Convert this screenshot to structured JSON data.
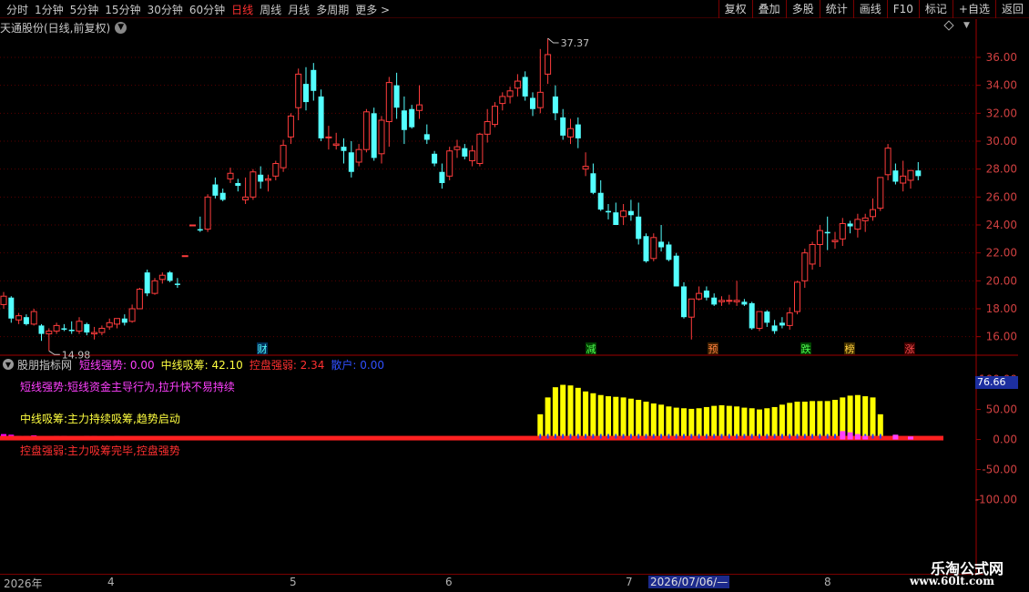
{
  "toolbar": {
    "periods": [
      "分时",
      "1分钟",
      "5分钟",
      "15分钟",
      "30分钟",
      "60分钟",
      "日线",
      "周线",
      "月线",
      "多周期",
      "更多 >"
    ],
    "active_period": "日线",
    "right_buttons": [
      "复权",
      "叠加",
      "多股",
      "统计",
      "画线",
      "F10",
      "标记",
      "+自选",
      "返回"
    ]
  },
  "stock_title": "天通股份(日线,前复权)",
  "indicator": {
    "name": "股朋指标网",
    "values": [
      {
        "label": "短线强势:",
        "value": "0.00",
        "color": "#ff40ff"
      },
      {
        "label": "中线吸筹:",
        "value": "42.10",
        "color": "#ffff40"
      },
      {
        "label": "控盘强弱:",
        "value": "2.34",
        "color": "#ff3030"
      },
      {
        "label": "散户:",
        "value": "0.00",
        "color": "#3050ff"
      }
    ],
    "desc1": "短线强势:短线资金主导行为,拉升快不易持续",
    "desc2": "中线吸筹:主力持续吸筹,趋势启动",
    "desc3": "控盘强弱:主力吸筹完毕,控盘强势",
    "cursor_value": "76.66"
  },
  "date_axis": {
    "labels": [
      "2026年",
      "4",
      "5",
      "6",
      "7",
      "8"
    ],
    "cursor_date": "2026/07/06/—"
  },
  "watermark": {
    "line1": "乐淘公式网",
    "line2": "www.60lt.com"
  },
  "colors": {
    "up": "#ff3c3c",
    "down": "#54ffff",
    "grid": "#5a0000",
    "axis": "#a00000"
  },
  "chart_data": [
    {
      "type": "candlestick",
      "ylim": [
        15,
        37.5
      ],
      "yticks": [
        16,
        18,
        20,
        22,
        24,
        26,
        28,
        30,
        32,
        34,
        36
      ],
      "high_label": "37.37",
      "low_label": "14.98",
      "event_markers": [
        "财",
        "减",
        "预",
        "跌",
        "榜",
        "涨"
      ],
      "ohlc": [
        [
          18.3,
          19.2,
          18.0,
          18.9
        ],
        [
          18.8,
          18.9,
          17.0,
          17.3
        ],
        [
          17.2,
          17.7,
          16.9,
          17.5
        ],
        [
          17.4,
          17.6,
          16.8,
          16.9
        ],
        [
          16.9,
          18.0,
          16.8,
          17.8
        ],
        [
          16.8,
          16.9,
          15.7,
          16.2
        ],
        [
          16.2,
          16.6,
          14.98,
          16.4
        ],
        [
          16.4,
          17.0,
          16.2,
          16.8
        ],
        [
          16.6,
          16.9,
          16.4,
          16.5
        ],
        [
          16.5,
          17.1,
          16.2,
          16.4
        ],
        [
          16.4,
          17.4,
          16.2,
          17.1
        ],
        [
          16.9,
          17.0,
          16.1,
          16.3
        ],
        [
          16.2,
          16.7,
          15.8,
          16.3
        ],
        [
          16.3,
          16.8,
          16.1,
          16.6
        ],
        [
          16.7,
          17.3,
          16.5,
          17.0
        ],
        [
          16.9,
          17.3,
          16.6,
          17.3
        ],
        [
          17.3,
          17.6,
          16.8,
          17.0
        ],
        [
          17.1,
          18.3,
          17.0,
          18.0
        ],
        [
          18.0,
          19.5,
          18.0,
          19.4
        ],
        [
          20.6,
          20.8,
          18.9,
          19.1
        ],
        [
          19.1,
          20.2,
          19.0,
          20.0
        ],
        [
          20.1,
          20.6,
          19.8,
          20.4
        ],
        [
          20.6,
          20.7,
          19.9,
          20.0
        ],
        [
          19.8,
          20.2,
          19.5,
          19.7
        ],
        [
          21.8,
          21.8,
          21.8,
          21.8
        ],
        [
          24.0,
          24.0,
          23.9,
          24.0
        ],
        [
          23.7,
          24.6,
          23.5,
          23.6
        ],
        [
          23.7,
          26.2,
          23.5,
          26.0
        ],
        [
          26.9,
          27.4,
          25.9,
          26.1
        ],
        [
          26.3,
          26.6,
          25.7,
          25.8
        ],
        [
          27.3,
          28.1,
          27.0,
          27.7
        ],
        [
          27.0,
          27.3,
          26.4,
          26.8
        ],
        [
          25.8,
          27.4,
          25.5,
          26.0
        ],
        [
          26.0,
          28.0,
          25.8,
          27.8
        ],
        [
          27.6,
          28.2,
          26.6,
          27.1
        ],
        [
          27.2,
          27.6,
          26.4,
          27.3
        ],
        [
          27.5,
          28.6,
          27.2,
          28.4
        ],
        [
          28.1,
          30.1,
          27.8,
          29.7
        ],
        [
          30.3,
          32.0,
          29.8,
          31.8
        ],
        [
          32.4,
          35.2,
          31.5,
          34.8
        ],
        [
          34.1,
          35.3,
          32.2,
          32.8
        ],
        [
          35.1,
          35.6,
          32.9,
          33.6
        ],
        [
          33.2,
          33.7,
          30.0,
          30.2
        ],
        [
          30.3,
          31.1,
          29.4,
          30.3
        ],
        [
          29.7,
          30.6,
          29.4,
          29.8
        ],
        [
          29.6,
          30.2,
          28.4,
          29.3
        ],
        [
          29.2,
          30.0,
          27.4,
          27.8
        ],
        [
          28.5,
          29.8,
          28.2,
          29.4
        ],
        [
          29.4,
          32.3,
          29.2,
          32.1
        ],
        [
          32.0,
          32.4,
          28.6,
          28.8
        ],
        [
          29.1,
          31.8,
          28.4,
          31.5
        ],
        [
          31.4,
          34.6,
          29.6,
          34.2
        ],
        [
          34.0,
          34.9,
          31.6,
          32.4
        ],
        [
          32.2,
          33.2,
          29.8,
          30.8
        ],
        [
          32.3,
          32.6,
          30.9,
          31.0
        ],
        [
          32.2,
          34.0,
          31.6,
          32.6
        ],
        [
          30.5,
          31.2,
          29.8,
          30.1
        ],
        [
          29.1,
          29.3,
          28.2,
          28.4
        ],
        [
          27.8,
          28.4,
          26.6,
          27.0
        ],
        [
          27.5,
          29.6,
          27.2,
          29.3
        ],
        [
          29.4,
          30.1,
          28.8,
          29.6
        ],
        [
          29.5,
          29.8,
          28.7,
          28.9
        ],
        [
          28.6,
          29.7,
          28.2,
          29.3
        ],
        [
          28.4,
          30.6,
          28.2,
          30.5
        ],
        [
          30.5,
          32.3,
          29.9,
          31.4
        ],
        [
          31.2,
          32.8,
          31.0,
          32.5
        ],
        [
          32.7,
          33.5,
          32.2,
          33.2
        ],
        [
          33.2,
          33.9,
          32.7,
          33.6
        ],
        [
          33.8,
          34.8,
          33.2,
          34.3
        ],
        [
          34.6,
          35.0,
          32.9,
          33.2
        ],
        [
          33.1,
          33.5,
          31.8,
          32.3
        ],
        [
          32.4,
          36.6,
          32.0,
          33.5
        ],
        [
          34.8,
          37.37,
          34.1,
          36.2
        ],
        [
          33.2,
          34.0,
          31.5,
          32.0
        ],
        [
          31.7,
          32.3,
          30.1,
          30.4
        ],
        [
          30.3,
          31.6,
          29.8,
          30.9
        ],
        [
          31.2,
          31.7,
          29.5,
          30.2
        ],
        [
          28.0,
          29.2,
          27.5,
          28.2
        ],
        [
          27.7,
          28.4,
          26.2,
          26.3
        ],
        [
          26.3,
          27.2,
          25.0,
          25.1
        ],
        [
          25.0,
          25.5,
          24.4,
          24.9
        ],
        [
          24.9,
          25.6,
          24.0,
          24.0
        ],
        [
          24.6,
          25.5,
          24.0,
          25.0
        ],
        [
          25.0,
          25.8,
          24.3,
          24.7
        ],
        [
          24.6,
          25.6,
          22.6,
          23.0
        ],
        [
          23.2,
          23.4,
          21.3,
          21.4
        ],
        [
          21.6,
          23.4,
          21.4,
          23.1
        ],
        [
          22.8,
          24.0,
          22.1,
          22.4
        ],
        [
          22.6,
          22.8,
          21.4,
          21.5
        ],
        [
          21.8,
          22.0,
          19.6,
          19.6
        ],
        [
          19.6,
          19.9,
          17.3,
          17.4
        ],
        [
          17.4,
          18.7,
          15.8,
          18.7
        ],
        [
          18.7,
          19.6,
          18.6,
          19.1
        ],
        [
          19.3,
          19.6,
          18.6,
          18.8
        ],
        [
          18.8,
          19.1,
          18.2,
          18.3
        ],
        [
          18.5,
          18.9,
          18.2,
          18.6
        ],
        [
          18.6,
          19.0,
          18.3,
          18.6
        ],
        [
          18.5,
          20.0,
          18.2,
          18.6
        ],
        [
          18.5,
          18.7,
          18.2,
          18.3
        ],
        [
          18.4,
          18.5,
          16.5,
          16.6
        ],
        [
          16.6,
          17.5,
          16.4,
          17.8
        ],
        [
          17.8,
          17.9,
          16.7,
          17.0
        ],
        [
          16.8,
          17.2,
          16.2,
          16.4
        ],
        [
          17.0,
          17.4,
          16.6,
          16.8
        ],
        [
          16.8,
          18.1,
          16.5,
          17.7
        ],
        [
          17.8,
          20.0,
          17.6,
          19.9
        ],
        [
          20.0,
          22.3,
          19.5,
          22.0
        ],
        [
          21.2,
          22.8,
          20.8,
          22.6
        ],
        [
          22.6,
          24.0,
          21.0,
          23.6
        ],
        [
          23.5,
          24.6,
          22.2,
          23.4
        ],
        [
          22.8,
          23.5,
          22.3,
          22.9
        ],
        [
          23.0,
          24.5,
          22.5,
          24.1
        ],
        [
          24.1,
          24.3,
          23.4,
          23.9
        ],
        [
          23.7,
          24.8,
          23.1,
          24.4
        ],
        [
          24.3,
          24.8,
          23.5,
          24.5
        ],
        [
          24.6,
          25.9,
          24.3,
          25.1
        ],
        [
          25.2,
          27.3,
          25.0,
          27.4
        ],
        [
          27.6,
          29.8,
          27.2,
          29.5
        ],
        [
          27.9,
          28.4,
          26.9,
          27.1
        ],
        [
          27.0,
          28.6,
          26.4,
          27.5
        ],
        [
          27.2,
          27.7,
          26.6,
          27.9
        ],
        [
          27.9,
          28.5,
          27.2,
          27.5
        ]
      ]
    },
    {
      "type": "bar",
      "ylim": [
        -125,
        110
      ],
      "yticks": [
        100,
        50,
        0,
        -50,
        -100
      ],
      "series": [
        {
          "name": "中线吸筹",
          "color": "#ffff00",
          "values": [
            0,
            0,
            0,
            0,
            0,
            0,
            0,
            0,
            0,
            0,
            0,
            0,
            0,
            0,
            0,
            0,
            0,
            0,
            0,
            0,
            0,
            0,
            0,
            0,
            0,
            0,
            0,
            0,
            0,
            0,
            0,
            0,
            0,
            0,
            0,
            0,
            0,
            0,
            0,
            0,
            0,
            0,
            0,
            0,
            0,
            0,
            0,
            0,
            0,
            0,
            0,
            0,
            0,
            0,
            0,
            0,
            0,
            0,
            0,
            0,
            0,
            0,
            0,
            0,
            0,
            0,
            0,
            0,
            0,
            0,
            0,
            0,
            0,
            0,
            0,
            0,
            0,
            0,
            0,
            0,
            0,
            0,
            0,
            0,
            0,
            0,
            0,
            0,
            0,
            0,
            0,
            0,
            0,
            0,
            0,
            0,
            0,
            0,
            0,
            0,
            0,
            0,
            0,
            0,
            0,
            0,
            0,
            0,
            0,
            0,
            0,
            0,
            0,
            0,
            0,
            0,
            0,
            0,
            0,
            0,
            0,
            0,
            0,
            0,
            0
          ]
        },
        {
          "name": "短线强势",
          "color": "#ff00ff",
          "values": [
            9,
            8,
            6,
            6,
            7,
            5,
            5,
            6,
            6,
            5,
            5,
            6,
            6,
            5,
            5,
            6,
            5,
            5,
            5,
            5,
            5,
            5,
            5,
            5,
            5,
            5,
            5,
            5,
            5,
            5,
            5,
            5,
            5,
            5,
            5,
            5,
            5,
            5,
            5,
            5,
            5,
            5,
            5,
            5,
            5,
            5,
            5,
            5,
            5,
            5,
            5,
            5,
            5,
            5,
            5,
            5,
            5,
            5,
            5,
            5,
            5,
            5,
            5,
            5,
            5,
            5,
            5,
            5,
            5,
            5,
            5,
            5,
            5,
            5,
            5,
            5,
            5,
            5,
            5,
            5,
            5,
            5,
            5,
            5,
            5,
            5,
            5,
            5,
            5,
            5,
            5,
            5,
            5,
            5,
            5,
            5,
            5,
            5,
            5,
            5,
            5,
            5,
            5,
            5,
            5,
            5,
            5,
            5,
            5,
            5,
            5,
            5,
            5,
            5,
            5,
            5,
            5,
            5,
            5,
            5,
            5,
            5,
            5,
            5,
            5
          ]
        },
        {
          "name": "控盘强弱",
          "color": "#ff2020",
          "values": [
            4,
            4,
            4,
            4,
            4,
            4,
            4,
            4,
            4,
            4,
            4,
            4,
            4,
            4,
            4,
            4,
            4,
            4,
            4,
            4,
            4,
            4,
            4,
            4,
            4,
            4,
            4,
            4,
            4,
            4,
            4,
            4,
            4,
            4,
            4,
            4,
            4,
            4,
            4,
            4,
            4,
            4,
            4,
            4,
            4,
            4,
            4,
            4,
            4,
            4,
            4,
            4,
            4,
            4,
            4,
            4,
            4,
            4,
            4,
            4,
            4,
            4,
            4,
            4,
            4,
            4,
            4,
            4,
            4,
            4,
            4,
            4,
            4,
            4,
            4,
            4,
            4,
            4,
            4,
            4,
            4,
            4,
            4,
            4,
            4,
            4,
            4,
            4,
            4,
            4,
            4,
            4,
            4,
            4,
            4,
            4,
            4,
            4,
            4,
            4,
            4,
            4,
            4,
            4,
            4,
            4,
            4,
            4,
            4,
            4,
            4,
            4,
            4,
            4,
            4,
            4,
            4,
            4,
            4,
            4,
            4,
            4,
            4,
            4,
            4
          ]
        }
      ],
      "yellow_start": 71,
      "yellow_values": [
        42,
        70,
        87,
        91,
        90,
        86,
        80,
        77,
        74,
        72,
        71,
        70,
        68,
        66,
        63,
        60,
        58,
        55,
        53,
        52,
        51,
        52,
        54,
        56,
        57,
        56,
        55,
        53,
        52,
        50,
        52,
        54,
        58,
        61,
        63,
        63,
        64,
        64,
        64,
        66,
        70,
        73,
        74,
        72,
        70,
        42
      ]
    }
  ]
}
